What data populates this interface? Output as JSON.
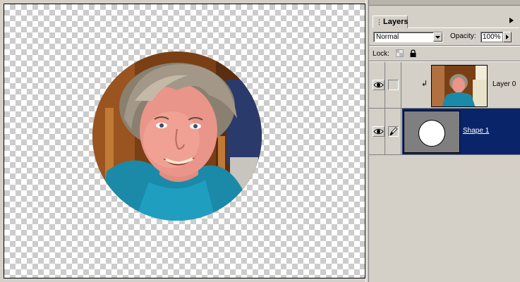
{
  "panel": {
    "tab_label": "Layers",
    "blend_mode": "Normal",
    "opacity_label": "Opacity:",
    "opacity_value": "100%",
    "lock_label": "Lock:"
  },
  "layers": [
    {
      "name": "Layer 0",
      "visible": true,
      "clipped": true,
      "thumbnail": "photo"
    },
    {
      "name": "Shape 1",
      "visible": true,
      "selected": true,
      "thumbnail": "white-circle-on-gray"
    }
  ],
  "colors": {
    "selection": "#0a246a",
    "panel_bg": "#d4d0c8",
    "shape_thumb_bg": "#7f7f7f"
  }
}
